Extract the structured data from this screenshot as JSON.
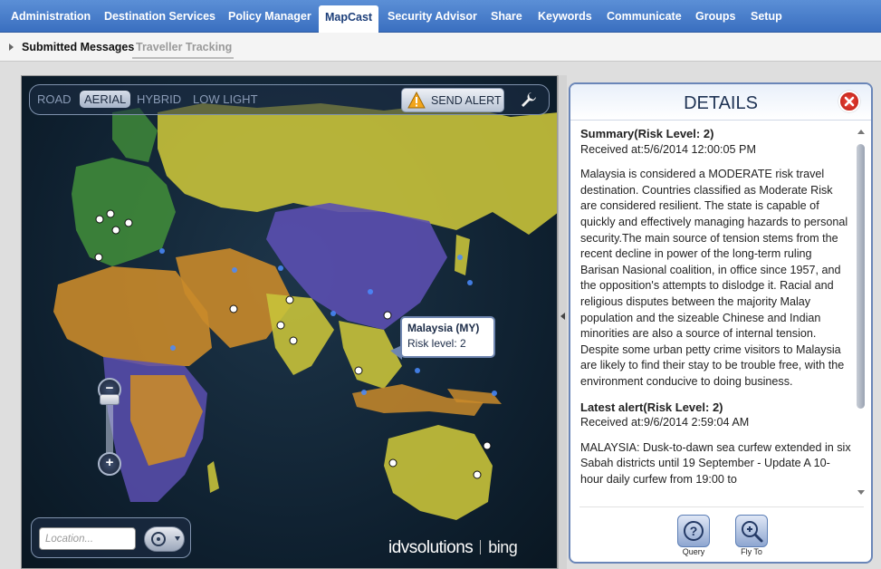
{
  "topnav": {
    "tabs": [
      {
        "label": "Administration"
      },
      {
        "label": "Destination Services"
      },
      {
        "label": "Policy Manager"
      },
      {
        "label": "MapCast"
      },
      {
        "label": "Security Advisor"
      },
      {
        "label": "Share"
      },
      {
        "label": "Keywords"
      },
      {
        "label": "Communicate"
      },
      {
        "label": "Groups"
      },
      {
        "label": "Setup"
      }
    ],
    "active": "MapCast"
  },
  "subnav": {
    "items": [
      {
        "label": "Submitted Messages"
      },
      {
        "label": "Traveller Tracking"
      }
    ]
  },
  "map": {
    "modes": [
      {
        "label": "ROAD"
      },
      {
        "label": "AERIAL"
      },
      {
        "label": "HYBRID"
      },
      {
        "label": "LOW LIGHT"
      }
    ],
    "active_mode": "AERIAL",
    "send_alert_label": "SEND ALERT",
    "location_placeholder": "Location...",
    "brand": {
      "left": "idvsolutions",
      "right": "bing"
    },
    "popup": {
      "title": "Malaysia (MY)",
      "risk": "Risk level: 2"
    },
    "zoom_plus": "+",
    "zoom_minus": "−"
  },
  "details": {
    "title": "DETAILS",
    "summary_heading": "Summary(Risk Level: 2)",
    "summary_received": "Received at:5/6/2014 12:00:05 PM",
    "summary_body": "Malaysia is considered a MODERATE risk travel destination. Countries classified as Moderate Risk are considered resilient. The state is capable of quickly and effectively managing hazards to personal security.The main source of tension stems from the recent decline in power of the long-term ruling Barisan Nasional coalition, in office since 1957, and the opposition's attempts to dislodge it. Racial and religious disputes between the majority Malay population and the sizeable Chinese and Indian minorities are also a source of internal tension. Despite some urban petty crime visitors to Malaysia are likely to find their stay to be trouble free, with the environment conducive to doing business.",
    "alert_heading": "Latest alert(Risk Level: 2)",
    "alert_received": "Received at:9/6/2014 2:59:04 AM",
    "alert_body": "MALAYSIA: Dusk-to-dawn sea curfew extended in six Sabah districts until 19 September - Update  A 10-hour daily curfew from 19:00 to",
    "actions": [
      {
        "label": "Query"
      },
      {
        "label": "Fly To"
      }
    ]
  },
  "colors": {
    "nav_blue": "#3a6fc0",
    "risk_yellow": "#c8c23a",
    "risk_orange": "#c98a2a",
    "risk_purple": "#5b4fb0",
    "risk_green": "#3f8a3a"
  }
}
